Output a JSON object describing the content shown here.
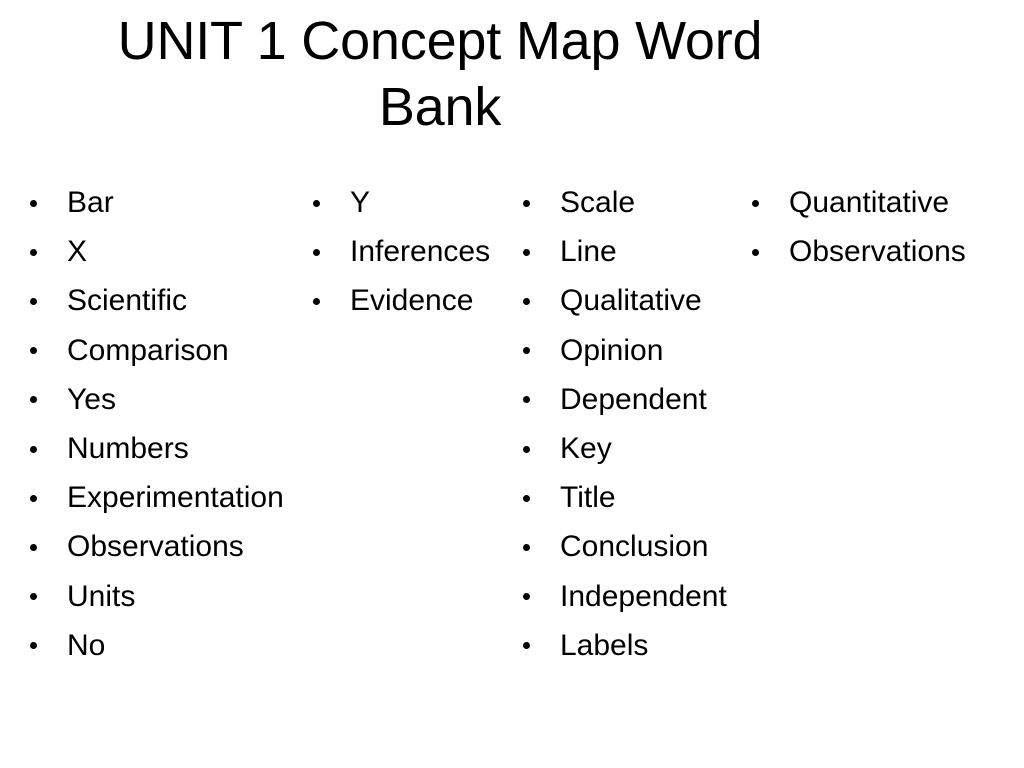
{
  "slide": {
    "background_color": "#ffffff",
    "text_color": "#000000",
    "title": {
      "full": "UNIT 1 Concept Map Word Bank",
      "line1": "UNIT 1 Concept Map Word",
      "line2": "Bank"
    },
    "columns": [
      {
        "id": "column-1",
        "items": [
          "Bar",
          "X",
          "Scientific",
          "Comparison",
          "Yes",
          "Numbers",
          "Experimentation",
          "Observations",
          "Units",
          "No"
        ]
      },
      {
        "id": "column-2",
        "items": [
          "Y",
          "Inferences",
          "Evidence"
        ]
      },
      {
        "id": "column-3",
        "items": [
          "Scale",
          "Line",
          "Qualitative",
          "Opinion",
          "Dependent",
          "Key",
          "Title",
          "Conclusion",
          "Independent",
          "Labels"
        ]
      },
      {
        "id": "column-4",
        "items": [
          "Quantitative",
          "Observations"
        ]
      }
    ]
  }
}
